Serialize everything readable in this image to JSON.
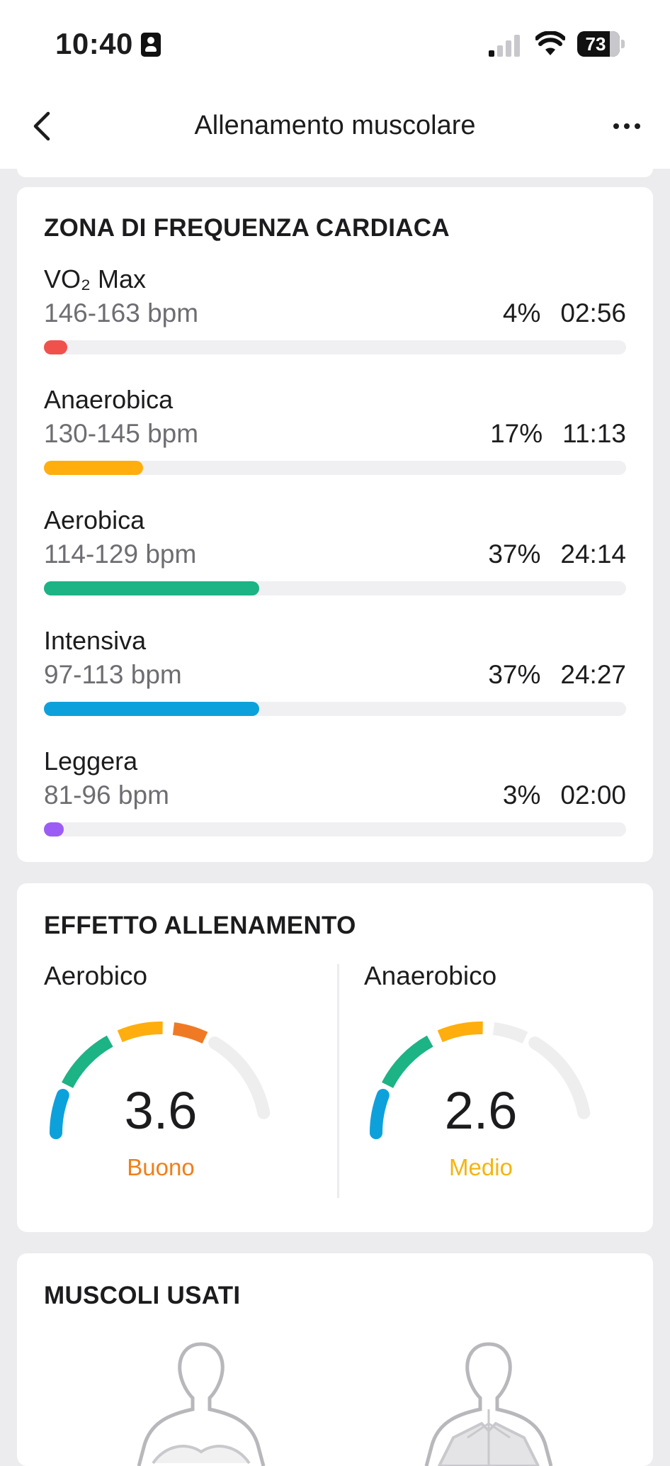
{
  "status": {
    "time": "10:40",
    "battery": "73"
  },
  "nav": {
    "title": "Allenamento muscolare"
  },
  "heart_rate": {
    "title": "ZONA DI FREQUENZA CARDIACA",
    "zones": [
      {
        "name": "VO₂ Max",
        "range": "146-163 bpm",
        "percent": "4%",
        "duration": "02:56",
        "fraction": 0.04,
        "color": "#f0524b"
      },
      {
        "name": "Anaerobica",
        "range": "130-145 bpm",
        "percent": "17%",
        "duration": "11:13",
        "fraction": 0.17,
        "color": "#ffae0d"
      },
      {
        "name": "Aerobica",
        "range": "114-129 bpm",
        "percent": "37%",
        "duration": "24:14",
        "fraction": 0.37,
        "color": "#1cb385"
      },
      {
        "name": "Intensiva",
        "range": "97-113 bpm",
        "percent": "37%",
        "duration": "24:27",
        "fraction": 0.37,
        "color": "#0da1dc"
      },
      {
        "name": "Leggera",
        "range": "81-96 bpm",
        "percent": "3%",
        "duration": "02:00",
        "fraction": 0.03,
        "color": "#9b5cf6"
      }
    ]
  },
  "training_effect": {
    "title": "EFFETTO ALLENAMENTO",
    "aerobic": {
      "label": "Aerobico",
      "value": "3.6",
      "rating": "Buono",
      "rating_color": "#f07f1a",
      "filled_segments": 4
    },
    "anaerobic": {
      "label": "Anaerobico",
      "value": "2.6",
      "rating": "Medio",
      "rating_color": "#f5b40f",
      "filled_segments": 3
    }
  },
  "muscles": {
    "title": "MUSCOLI USATI"
  },
  "colors": {
    "gauge_segments": [
      "#0da1dc",
      "#1cb385",
      "#ffae0d",
      "#f07a24",
      "#f0f0f2"
    ],
    "gauge_empty": "#eeeeef"
  }
}
